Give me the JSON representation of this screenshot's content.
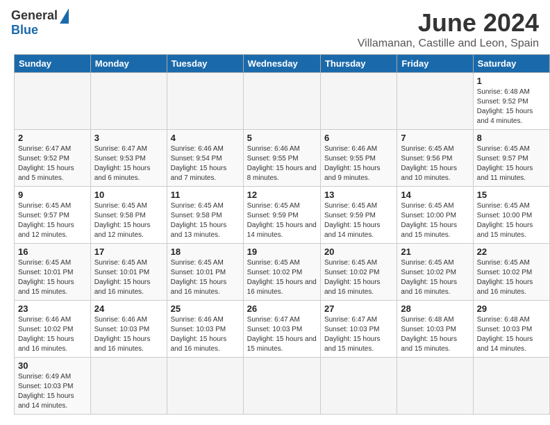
{
  "header": {
    "logo_text_general": "General",
    "logo_text_blue": "Blue",
    "month_title": "June 2024",
    "location": "Villamanan, Castille and Leon, Spain"
  },
  "weekdays": [
    "Sunday",
    "Monday",
    "Tuesday",
    "Wednesday",
    "Thursday",
    "Friday",
    "Saturday"
  ],
  "days": [
    {
      "date": "",
      "empty": true
    },
    {
      "date": "",
      "empty": true
    },
    {
      "date": "",
      "empty": true
    },
    {
      "date": "",
      "empty": true
    },
    {
      "date": "",
      "empty": true
    },
    {
      "date": "",
      "empty": true
    },
    {
      "date": "1",
      "sunrise": "6:48 AM",
      "sunset": "9:52 PM",
      "daylight": "15 hours and 4 minutes."
    },
    {
      "date": "2",
      "sunrise": "6:47 AM",
      "sunset": "9:52 PM",
      "daylight": "15 hours and 5 minutes."
    },
    {
      "date": "3",
      "sunrise": "6:47 AM",
      "sunset": "9:53 PM",
      "daylight": "15 hours and 6 minutes."
    },
    {
      "date": "4",
      "sunrise": "6:46 AM",
      "sunset": "9:54 PM",
      "daylight": "15 hours and 7 minutes."
    },
    {
      "date": "5",
      "sunrise": "6:46 AM",
      "sunset": "9:55 PM",
      "daylight": "15 hours and 8 minutes."
    },
    {
      "date": "6",
      "sunrise": "6:46 AM",
      "sunset": "9:55 PM",
      "daylight": "15 hours and 9 minutes."
    },
    {
      "date": "7",
      "sunrise": "6:45 AM",
      "sunset": "9:56 PM",
      "daylight": "15 hours and 10 minutes."
    },
    {
      "date": "8",
      "sunrise": "6:45 AM",
      "sunset": "9:57 PM",
      "daylight": "15 hours and 11 minutes."
    },
    {
      "date": "9",
      "sunrise": "6:45 AM",
      "sunset": "9:57 PM",
      "daylight": "15 hours and 12 minutes."
    },
    {
      "date": "10",
      "sunrise": "6:45 AM",
      "sunset": "9:58 PM",
      "daylight": "15 hours and 12 minutes."
    },
    {
      "date": "11",
      "sunrise": "6:45 AM",
      "sunset": "9:58 PM",
      "daylight": "15 hours and 13 minutes."
    },
    {
      "date": "12",
      "sunrise": "6:45 AM",
      "sunset": "9:59 PM",
      "daylight": "15 hours and 14 minutes."
    },
    {
      "date": "13",
      "sunrise": "6:45 AM",
      "sunset": "9:59 PM",
      "daylight": "15 hours and 14 minutes."
    },
    {
      "date": "14",
      "sunrise": "6:45 AM",
      "sunset": "10:00 PM",
      "daylight": "15 hours and 15 minutes."
    },
    {
      "date": "15",
      "sunrise": "6:45 AM",
      "sunset": "10:00 PM",
      "daylight": "15 hours and 15 minutes."
    },
    {
      "date": "16",
      "sunrise": "6:45 AM",
      "sunset": "10:01 PM",
      "daylight": "15 hours and 15 minutes."
    },
    {
      "date": "17",
      "sunrise": "6:45 AM",
      "sunset": "10:01 PM",
      "daylight": "15 hours and 16 minutes."
    },
    {
      "date": "18",
      "sunrise": "6:45 AM",
      "sunset": "10:01 PM",
      "daylight": "15 hours and 16 minutes."
    },
    {
      "date": "19",
      "sunrise": "6:45 AM",
      "sunset": "10:02 PM",
      "daylight": "15 hours and 16 minutes."
    },
    {
      "date": "20",
      "sunrise": "6:45 AM",
      "sunset": "10:02 PM",
      "daylight": "15 hours and 16 minutes."
    },
    {
      "date": "21",
      "sunrise": "6:45 AM",
      "sunset": "10:02 PM",
      "daylight": "15 hours and 16 minutes."
    },
    {
      "date": "22",
      "sunrise": "6:45 AM",
      "sunset": "10:02 PM",
      "daylight": "15 hours and 16 minutes."
    },
    {
      "date": "23",
      "sunrise": "6:46 AM",
      "sunset": "10:02 PM",
      "daylight": "15 hours and 16 minutes."
    },
    {
      "date": "24",
      "sunrise": "6:46 AM",
      "sunset": "10:03 PM",
      "daylight": "15 hours and 16 minutes."
    },
    {
      "date": "25",
      "sunrise": "6:46 AM",
      "sunset": "10:03 PM",
      "daylight": "15 hours and 16 minutes."
    },
    {
      "date": "26",
      "sunrise": "6:47 AM",
      "sunset": "10:03 PM",
      "daylight": "15 hours and 15 minutes."
    },
    {
      "date": "27",
      "sunrise": "6:47 AM",
      "sunset": "10:03 PM",
      "daylight": "15 hours and 15 minutes."
    },
    {
      "date": "28",
      "sunrise": "6:48 AM",
      "sunset": "10:03 PM",
      "daylight": "15 hours and 15 minutes."
    },
    {
      "date": "29",
      "sunrise": "6:48 AM",
      "sunset": "10:03 PM",
      "daylight": "15 hours and 14 minutes."
    },
    {
      "date": "30",
      "sunrise": "6:49 AM",
      "sunset": "10:03 PM",
      "daylight": "15 hours and 14 minutes."
    }
  ],
  "labels": {
    "sunrise": "Sunrise: ",
    "sunset": "Sunset: ",
    "daylight": "Daylight: "
  }
}
